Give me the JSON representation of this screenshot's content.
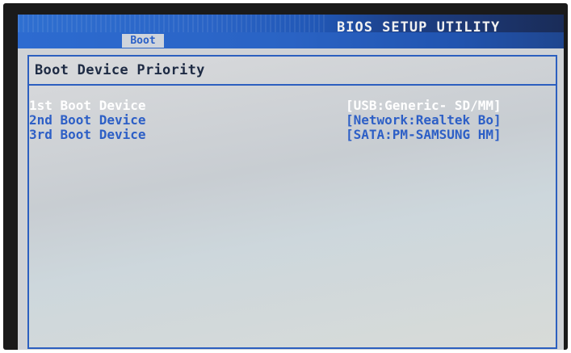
{
  "header": {
    "title": "BIOS SETUP UTILITY",
    "active_tab": "Boot"
  },
  "panel": {
    "title": "Boot Device Priority"
  },
  "boot_devices": [
    {
      "label": "1st Boot Device",
      "value": "[USB:Generic- SD/MM]",
      "selected": true
    },
    {
      "label": "2nd Boot Device",
      "value": "[Network:Realtek Bo]",
      "selected": false
    },
    {
      "label": "3rd Boot Device",
      "value": "[SATA:PM-SAMSUNG HM]",
      "selected": false
    }
  ],
  "colors": {
    "accent_blue": "#2d5fc6",
    "selected_text": "#ffffff",
    "background": "#cfd2d6"
  }
}
